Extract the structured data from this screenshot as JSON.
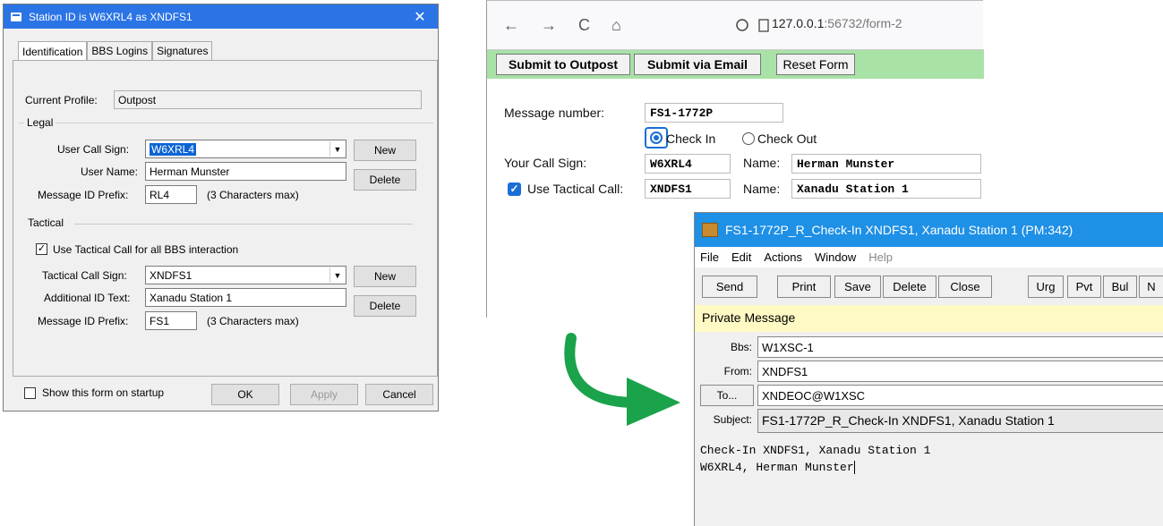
{
  "dialog": {
    "title": "Station ID is W6XRL4 as XNDFS1",
    "tabs": [
      "Identification",
      "BBS Logins",
      "Signatures"
    ],
    "current_profile_label": "Current Profile:",
    "current_profile_value": "Outpost",
    "legal_group": "Legal",
    "user_call_sign_label": "User Call Sign:",
    "user_call_sign_value": "W6XRL4",
    "user_name_label": "User Name:",
    "user_name_value": "Herman Munster",
    "msg_prefix_label": "Message ID Prefix:",
    "legal_prefix_value": "RL4",
    "chars_max": "(3 Characters max)",
    "new_label": "New",
    "delete_label": "Delete",
    "tactical_group": "Tactical",
    "use_tactical_label": "Use Tactical Call for all BBS interaction",
    "tactical_call_label": "Tactical Call Sign:",
    "tactical_call_value": "XNDFS1",
    "additional_id_label": "Additional ID Text:",
    "additional_id_value": "Xanadu Station 1",
    "tactical_prefix_value": "FS1",
    "show_on_startup_label": "Show this form on startup",
    "ok_label": "OK",
    "apply_label": "Apply",
    "cancel_label": "Cancel"
  },
  "browser": {
    "url_host": "127.0.0.1",
    "url_path": ":56732/form-2",
    "submit_outpost": "Submit to Outpost",
    "submit_email": "Submit via Email",
    "reset_form": "Reset Form",
    "message_number_label": "Message number:",
    "message_number_value": "FS1-1772P",
    "check_in_label": "Check In",
    "check_out_label": "Check Out",
    "your_call_sign_label": "Your Call Sign:",
    "your_call_sign_value": "W6XRL4",
    "name_label": "Name:",
    "name_value": "Herman Munster",
    "use_tactical_label": "Use Tactical Call:",
    "tactical_value": "XNDFS1",
    "tactical_name_value": "Xanadu Station 1"
  },
  "message": {
    "title": "FS1-1772P_R_Check-In XNDFS1, Xanadu Station 1  (PM:342)",
    "menu": [
      "File",
      "Edit",
      "Actions",
      "Window",
      "Help"
    ],
    "toolbar": [
      "Send",
      "Print",
      "Save",
      "Delete",
      "Close",
      "Urg",
      "Pvt",
      "Bul",
      "N"
    ],
    "private_label": "Private Message",
    "bbs_label": "Bbs:",
    "bbs_value": "W1XSC-1",
    "from_label": "From:",
    "from_value": "XNDFS1",
    "to_button": "To...",
    "to_value": "XNDEOC@W1XSC",
    "subject_label": "Subject:",
    "subject_value": "FS1-1772P_R_Check-In XNDFS1, Xanadu Station 1",
    "body_line1": "Check-In XNDFS1, Xanadu Station 1",
    "body_line2": "W6XRL4, Herman Munster"
  },
  "colors": {
    "arrow": "#1aa34a",
    "green_bar": "#a9e2a6",
    "title_blue": "#2b74e6"
  }
}
